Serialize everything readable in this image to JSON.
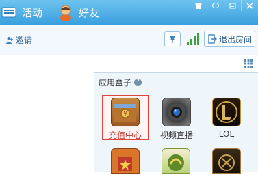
{
  "topbar": {
    "activity_label": "活动",
    "friends_label": "好友",
    "system_buttons": [
      "shirt-icon",
      "chat-icon",
      "minimize-icon",
      "close-icon"
    ]
  },
  "toolbar": {
    "invite_label": "邀请",
    "exit_label": "退出房间"
  },
  "appbox": {
    "title": "应用盒子",
    "apps": [
      {
        "label": "充值中心",
        "icon": "wallet-icon",
        "selected": true
      },
      {
        "label": "视频直播",
        "icon": "camera-icon",
        "selected": false
      },
      {
        "label": "LOL",
        "icon": "lol-icon",
        "selected": false
      }
    ],
    "partial_row": [
      "star-game-icon",
      "game-icon-2",
      "game-icon-3"
    ]
  },
  "colors": {
    "topbar": "#3aa0de",
    "accent": "#2a5c8a",
    "selected_border": "#e0463f"
  }
}
